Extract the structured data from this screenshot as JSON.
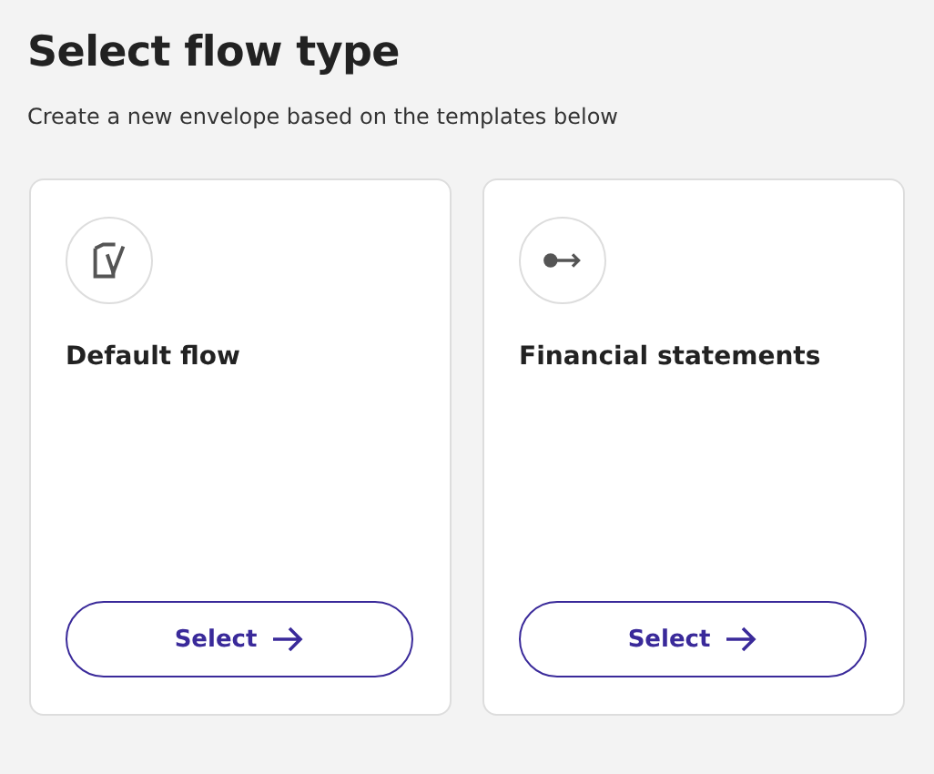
{
  "header": {
    "title": "Select flow type",
    "subtitle": "Create a new envelope based on the templates below"
  },
  "cards": [
    {
      "kind": "document",
      "title": "Default flow",
      "button": "Select"
    },
    {
      "kind": "connector",
      "title": "Financial statements",
      "button": "Select"
    }
  ]
}
